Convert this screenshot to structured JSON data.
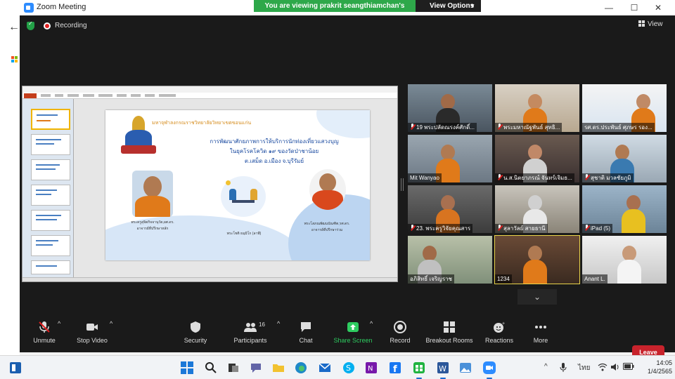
{
  "window": {
    "title": "Zoom Meeting",
    "viewing_banner": "You are viewing prakrit seangthiamchan's screen",
    "view_options": "View Options"
  },
  "meeting": {
    "recording_label": "Recording",
    "view_label": "View"
  },
  "slide": {
    "university": "มหาจุฬาลงกรณราชวิทยาลัยวิทยาเขตขอนแก่น",
    "title_line1": "การพัฒนาศักยภาพการให้บริการนักท่องเที่ยวแสวงบุญ",
    "title_line2": "ในยุคโรคโควิด ๑๙ ของวัดป่าชาน้อย",
    "title_line3": "ต.เสม็ด อ.เมือง จ.บุรีรัมย์",
    "person_left_caption1": "พระครูสุจิตกิจจานุวัต,ผศ.ดร.",
    "person_left_caption2": "อาจารย์ที่ปรึกษาหลัก",
    "person_center_caption": "พระโชติ ธมฺมิโก (ลาพี)",
    "person_right_caption1": "พระโสภณพัฒนบัณฑิต,รศ.ดร.",
    "person_right_caption2": "อาจารย์ที่ปรึกษาร่วม"
  },
  "gallery": {
    "participants": [
      {
        "name": "19 พระปลัดณรงค์ศักดิ์...",
        "muted": true
      },
      {
        "name": "พระมหาณัฐพันธ์ สุทธิ...",
        "muted": true
      },
      {
        "name": "รศ.ดร.ประพันธ์ ศุภษร รอง...",
        "muted": false
      },
      {
        "name": "Mit Wanyao",
        "muted": false
      },
      {
        "name": "น.ส.นิตยาภรณ์ จันทร์เจิมธ...",
        "muted": true
      },
      {
        "name": "สุชาติ มวลชัยภูมิ",
        "muted": true
      },
      {
        "name": "23. พระครูวิจัยคุณสาร",
        "muted": true
      },
      {
        "name": "สุลาวัลย์ สายธานี",
        "muted": true
      },
      {
        "name": "iPad (5)",
        "muted": true
      },
      {
        "name": "อภิสิทธิ์ เจริญราช",
        "muted": false
      },
      {
        "name": "1234",
        "muted": false
      },
      {
        "name": "Anant L.",
        "muted": false
      }
    ]
  },
  "toolbar": {
    "unmute": "Unmute",
    "stop_video": "Stop Video",
    "security": "Security",
    "participants": "Participants",
    "participants_count": "16",
    "chat": "Chat",
    "share_screen": "Share Screen",
    "record": "Record",
    "breakout_rooms": "Breakout Rooms",
    "reactions": "Reactions",
    "more": "More",
    "leave": "Leave"
  },
  "taskbar": {
    "language": "ไทย",
    "time": "14:05",
    "date": "1/4/2565"
  },
  "colors": {
    "leave_red": "#c8232c",
    "banner_green": "#2ea84a",
    "share_green": "#2ecc60",
    "active_speaker": "#e8d44a"
  }
}
